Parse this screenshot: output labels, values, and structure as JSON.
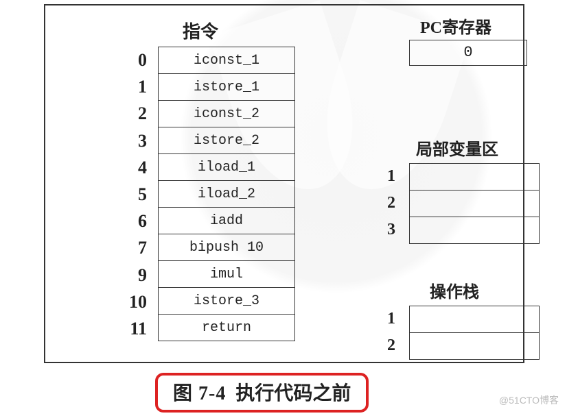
{
  "headers": {
    "instructions": "指令",
    "pc_register": "PC寄存器",
    "local_vars": "局部变量区",
    "operand_stack": "操作栈"
  },
  "instruction_table": {
    "offsets": [
      "0",
      "1",
      "2",
      "3",
      "4",
      "5",
      "6",
      "7",
      "9",
      "10",
      "11"
    ],
    "ops": [
      "iconst_1",
      "istore_1",
      "iconst_2",
      "istore_2",
      "iload_1",
      "iload_2",
      "iadd",
      "bipush  10",
      "imul",
      "istore_3",
      "return"
    ]
  },
  "pc_register_value": "0",
  "local_vars": {
    "indices": [
      "1",
      "2",
      "3"
    ],
    "values": [
      "",
      "",
      ""
    ]
  },
  "operand_stack": {
    "indices": [
      "1",
      "2"
    ],
    "values": [
      "",
      ""
    ]
  },
  "caption": {
    "label": "图 7-4",
    "text": "执行代码之前"
  },
  "credit": "@51CTO博客"
}
